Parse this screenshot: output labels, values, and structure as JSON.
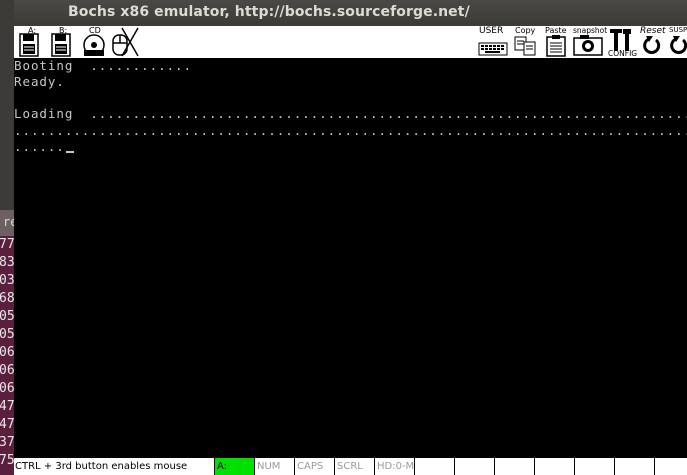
{
  "window": {
    "title": "Bochs x86 emulator, http://bochs.sourceforge.net/"
  },
  "background": {
    "tab_label": "re",
    "line_numbers": [
      "77",
      "83",
      "03",
      "68",
      "05",
      "05",
      "06",
      "06",
      "06",
      "47",
      "47",
      "37",
      "75"
    ]
  },
  "toolbar": {
    "floppy_a_label": "A:",
    "floppy_b_label": "B:",
    "cdrom_label": "CD",
    "user_label": "USER",
    "copy_label": "Copy",
    "paste_label": "Paste",
    "snapshot_label": "snapshot",
    "config_label": "CONFIG",
    "reset_label": "Reset",
    "suspend_label": "SUSP"
  },
  "screen": {
    "lines": [
      "Booting  ............",
      "Ready.",
      "",
      "Loading  ..........................................................................",
      "..................................................................................",
      "......"
    ]
  },
  "statusbar": {
    "message": "CTRL + 3rd button enables mouse",
    "floppy_a": "A:",
    "num": "NUM",
    "caps": "CAPS",
    "scrl": "SCRL",
    "hd": "HD:0-M"
  },
  "colors": {
    "screen_bg": "#000000",
    "text": "#c8c8c8",
    "led_on": "#00e000",
    "titlebar": "#3c3b37"
  }
}
